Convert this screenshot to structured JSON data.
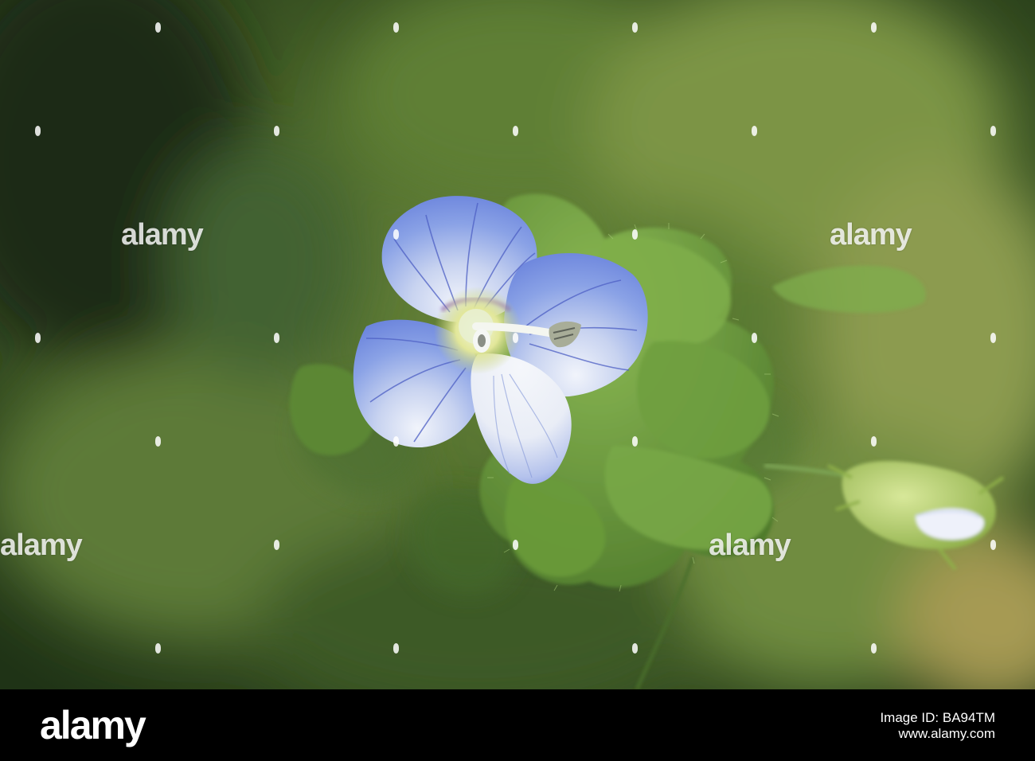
{
  "watermark": {
    "text": "alamy"
  },
  "footer": {
    "brand": "alamy",
    "image_id_label": "Image ID: BA94TM",
    "website": "www.alamy.com"
  },
  "colors": {
    "background_green": "#3f5a28",
    "petal_blue": "#6e8be0",
    "petal_white": "#eef2f8",
    "flower_center": "#e6eba0",
    "leaf_green": "#6a9a3c",
    "footer_black": "#000000"
  }
}
